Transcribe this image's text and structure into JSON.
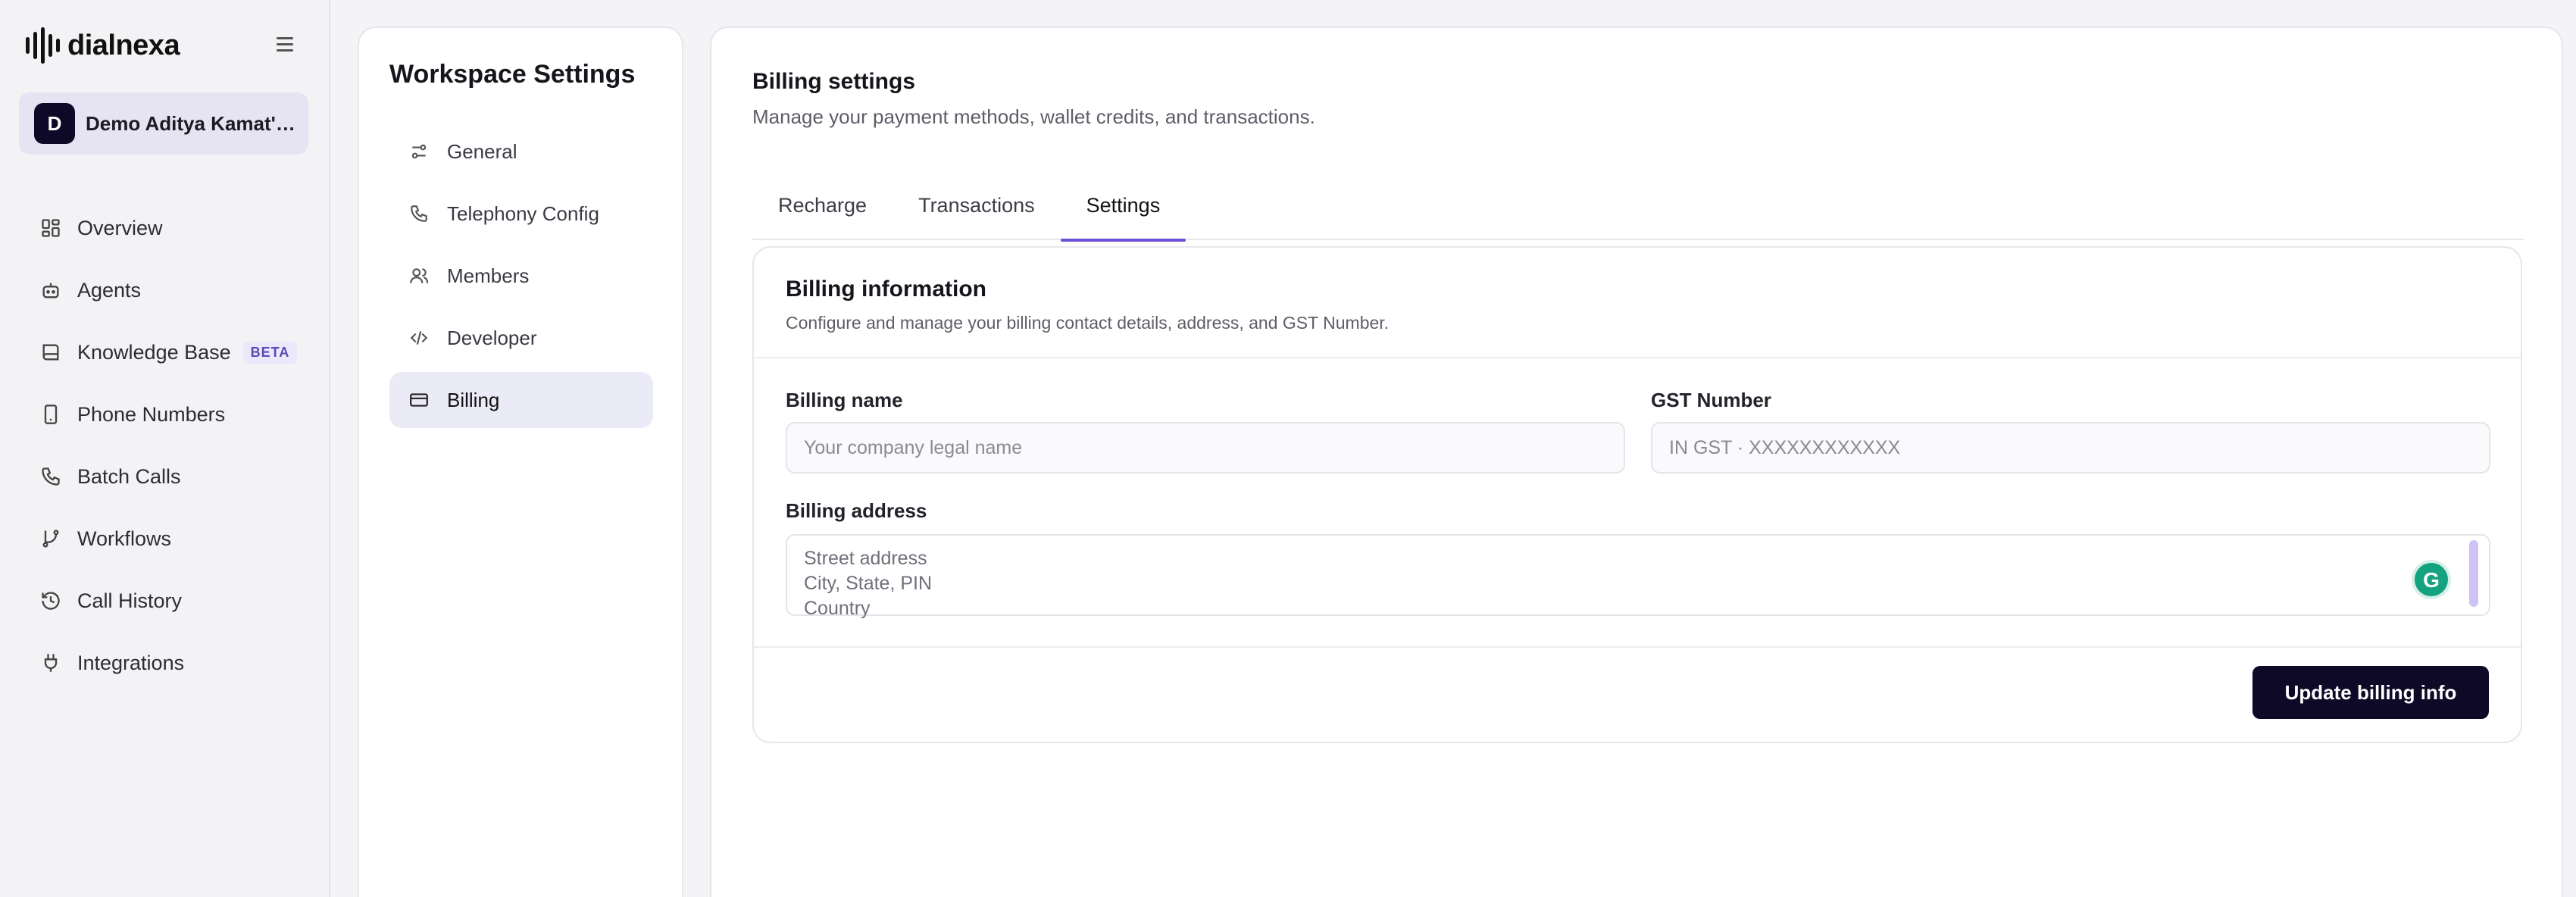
{
  "brand": {
    "name": "dialnexa"
  },
  "workspace": {
    "initial": "D",
    "name": "Demo Aditya Kamat's …"
  },
  "sidebar": {
    "items": [
      {
        "label": "Overview",
        "icon": "dashboard-icon"
      },
      {
        "label": "Agents",
        "icon": "robot-icon"
      },
      {
        "label": "Knowledge Base",
        "icon": "book-icon",
        "badge": "BETA"
      },
      {
        "label": "Phone Numbers",
        "icon": "phone-device-icon"
      },
      {
        "label": "Batch Calls",
        "icon": "phone-icon"
      },
      {
        "label": "Workflows",
        "icon": "git-branch-icon"
      },
      {
        "label": "Call History",
        "icon": "history-icon"
      },
      {
        "label": "Integrations",
        "icon": "plug-icon"
      }
    ]
  },
  "settings_nav": {
    "title": "Workspace Settings",
    "items": [
      {
        "label": "General",
        "icon": "sliders-icon"
      },
      {
        "label": "Telephony Config",
        "icon": "phone-icon"
      },
      {
        "label": "Members",
        "icon": "users-icon"
      },
      {
        "label": "Developer",
        "icon": "code-icon"
      },
      {
        "label": "Billing",
        "icon": "credit-card-icon",
        "active": true
      }
    ]
  },
  "main": {
    "title": "Billing settings",
    "subtitle": "Manage your payment methods, wallet credits, and transactions.",
    "tabs": [
      {
        "label": "Recharge"
      },
      {
        "label": "Transactions"
      },
      {
        "label": "Settings",
        "active": true
      }
    ]
  },
  "billing_card": {
    "title": "Billing information",
    "subtitle": "Configure and manage your billing contact details, address, and GST Number.",
    "billing_name_label": "Billing name",
    "billing_name_placeholder": "Your company legal name",
    "gst_label": "GST Number",
    "gst_placeholder": "IN GST · XXXXXXXXXXXX",
    "address_label": "Billing address",
    "address_placeholder_lines": [
      "Street address",
      "City, State, PIN",
      "Country"
    ],
    "submit_label": "Update billing info"
  },
  "colors": {
    "accent": "#6d4fd8",
    "primary_button": "#0d0926",
    "active_bg": "#ebeaf7"
  }
}
